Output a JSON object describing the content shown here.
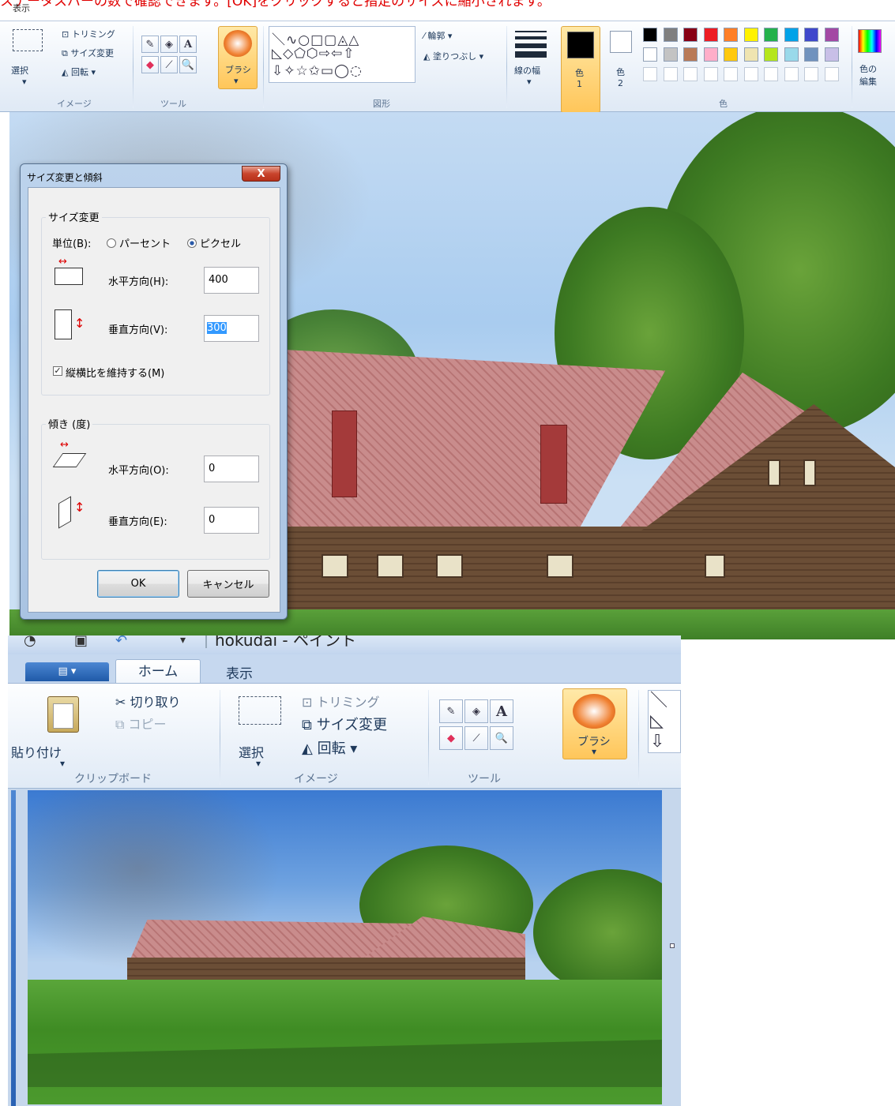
{
  "top_banner": "ステータスバーの数で確認できます。[OK]をクリックすると指定のサイズに縮小されます。",
  "top_menu_fragment": "表示",
  "ribbon1": {
    "image_group": {
      "select_label": "選択",
      "trim_label": "トリミング",
      "resize_label": "サイズ変更",
      "rotate_label": "回転",
      "group_label": "イメージ"
    },
    "tools_group": {
      "group_label": "ツール",
      "text_tool": "A"
    },
    "brush_label": "ブラシ",
    "shapes_group": {
      "outline_label": "輪郭",
      "fill_label": "塗りつぶし",
      "group_label": "図形"
    },
    "line_width_label": "線の幅",
    "color1_label": "色",
    "color1_num": "1",
    "color2_label": "色",
    "color2_num": "2",
    "colors_group_label": "色",
    "edit_colors_line1": "色の",
    "edit_colors_line2": "編集",
    "palette_row1": [
      "#000000",
      "#7f7f7f",
      "#880015",
      "#ed1c24",
      "#ff7f27",
      "#fff200",
      "#22b14c",
      "#00a2e8",
      "#3f48cc",
      "#a349a4"
    ],
    "palette_row2": [
      "#ffffff",
      "#c3c3c3",
      "#b97a57",
      "#ffaec9",
      "#ffc90e",
      "#efe4b0",
      "#b5e61d",
      "#99d9ea",
      "#7092be",
      "#c8bfe7"
    ]
  },
  "dialog": {
    "title": "サイズ変更と傾斜",
    "close_label": "X",
    "resize_section": "サイズ変更",
    "unit_label": "単位(B):",
    "unit_percent": "パーセント",
    "unit_pixel": "ピクセル",
    "horizontal_label": "水平方向(H):",
    "horizontal_value": "400",
    "vertical_label": "垂直方向(V):",
    "vertical_value": "300",
    "keep_ratio_label": "縦横比を維持する(M)",
    "skew_section": "傾き (度)",
    "skew_h_label": "水平方向(O):",
    "skew_h_value": "0",
    "skew_v_label": "垂直方向(E):",
    "skew_v_value": "0",
    "ok_label": "OK",
    "cancel_label": "キャンセル"
  },
  "window2": {
    "title_fragment": "hokudai - ペイント",
    "tab_home": "ホーム",
    "tab_view": "表示",
    "paste_label": "貼り付け",
    "cut_label": "切り取り",
    "copy_label": "コピー",
    "clipboard_group": "クリップボード",
    "select_label": "選択",
    "trim_label": "トリミング",
    "resize_label": "サイズ変更",
    "rotate_label": "回転",
    "image_group": "イメージ",
    "tools_group": "ツール",
    "text_tool": "A",
    "brush_label": "ブラシ"
  },
  "colors": {
    "accent_orange": "#ffc65a",
    "dialog_frame": "#a9c3e2",
    "banner_red": "#e00000"
  }
}
